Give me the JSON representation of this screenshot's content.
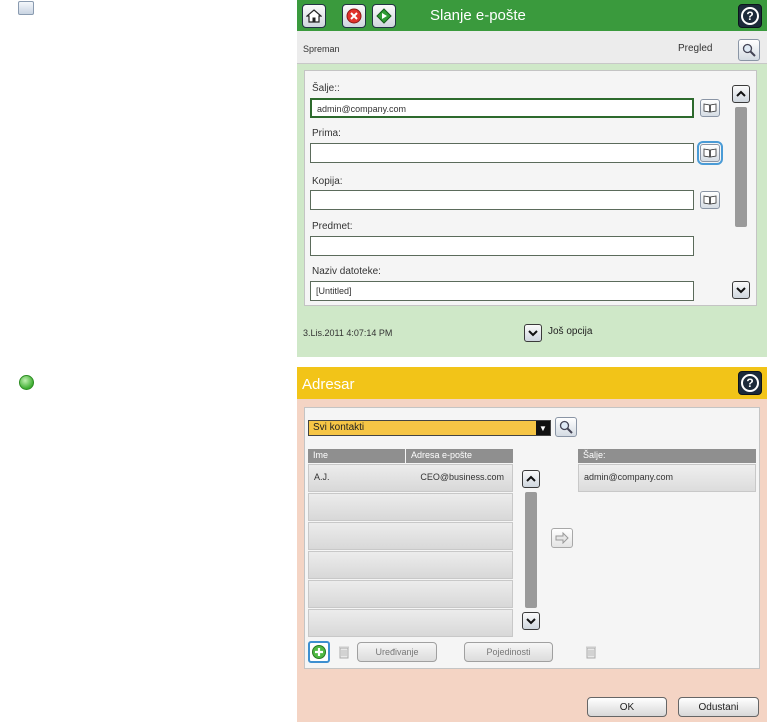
{
  "email": {
    "title": "Slanje e-pošte",
    "status": "Spreman",
    "preview_label": "Pregled",
    "from_label": "Šalje::",
    "from_value": "admin@company.com",
    "to_label": "Prima:",
    "to_value": "",
    "cc_label": "Kopija:",
    "cc_value": "",
    "subject_label": "Predmet:",
    "subject_value": "",
    "filename_label": "Naziv datoteke:",
    "filename_value": "[Untitled]",
    "datetime": "3.Lis.2011 4:07:14 PM",
    "more_options": "Još opcija"
  },
  "addressbook": {
    "title": "Adresar",
    "filter_selected": "Svi kontakti",
    "col_name": "Ime",
    "col_email": "Adresa e-pošte",
    "col_sender": "Šalje:",
    "contacts": [
      {
        "name": "A.J.",
        "email": "CEO@business.com"
      }
    ],
    "sender_value": "admin@company.com",
    "edit_label": "Uređivanje",
    "details_label": "Pojedinosti",
    "ok_label": "OK",
    "cancel_label": "Odustani"
  },
  "colors": {
    "email_header": "#3a9a3d",
    "addr_header": "#f2c418",
    "highlight": "#4a9bd6"
  },
  "icons": [
    "address-book-icon",
    "home-icon",
    "stop-icon",
    "start-icon",
    "help-icon",
    "search-icon",
    "scroll-up-icon",
    "scroll-down-icon",
    "add-contact-icon",
    "trash-icon",
    "arrow-right-icon"
  ]
}
